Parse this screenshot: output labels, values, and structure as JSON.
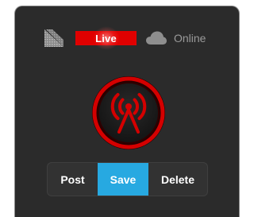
{
  "status": {
    "signal_icon": "signal-strength-icon",
    "live_label": "Live",
    "live_color": "#e00000",
    "cloud_icon": "cloud-icon",
    "online_label": "Online"
  },
  "broadcast": {
    "icon": "broadcast-antenna-icon",
    "accent_color": "#d40000"
  },
  "actions": {
    "post_label": "Post",
    "save_label": "Save",
    "delete_label": "Delete",
    "active_color": "#27a9e1"
  }
}
